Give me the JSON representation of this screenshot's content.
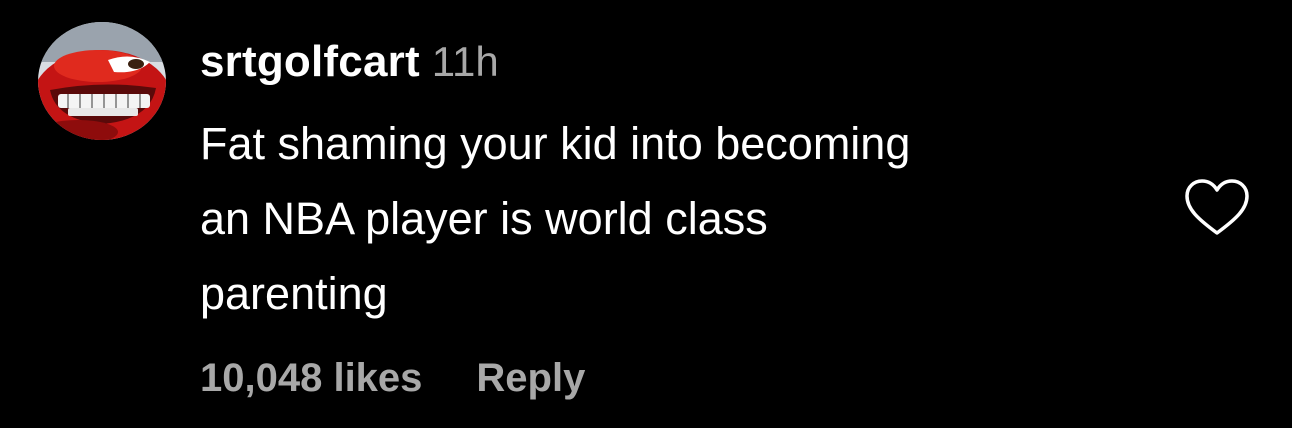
{
  "comment": {
    "avatar_icon": "cartoon-red-car-avatar",
    "username": "srtgolfcart",
    "timestamp": "11h",
    "text_lines": [
      "Fat shaming your kid into becoming",
      "an NBA player is world class",
      "parenting"
    ],
    "likes": "10,048 likes",
    "reply_label": "Reply",
    "like_icon": "heart-outline-icon"
  },
  "colors": {
    "background": "#000000",
    "primary_text": "#ffffff",
    "secondary_text": "#a8a8a8"
  }
}
